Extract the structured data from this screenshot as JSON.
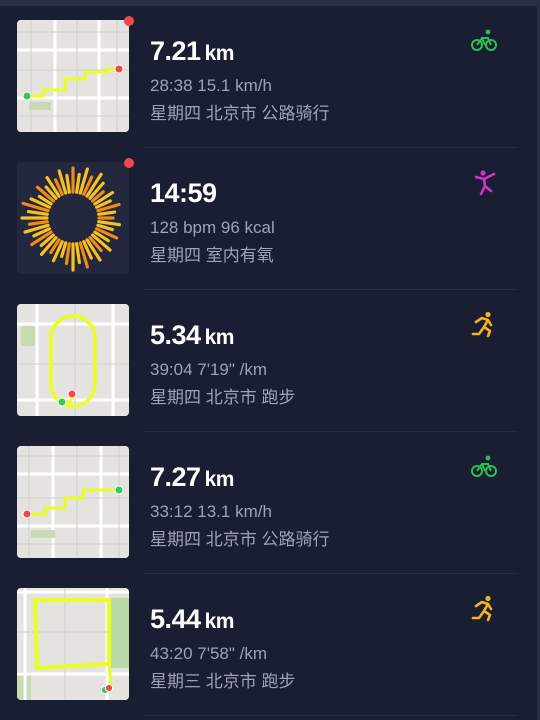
{
  "activities": [
    {
      "title_value": "7.21",
      "title_unit": "km",
      "stats": "28:38  15.1 km/h",
      "subtitle": "星期四 北京市 公路骑行",
      "sport": "cycling-icon",
      "icon_color": "#2fbf4f",
      "unread": true
    },
    {
      "title_value": "14:59",
      "title_unit": "",
      "stats": "128 bpm  96 kcal",
      "subtitle": "星期四 室内有氧",
      "sport": "yoga-icon",
      "icon_color": "#d033c9",
      "unread": true
    },
    {
      "title_value": "5.34",
      "title_unit": "km",
      "stats": "39:04  7'19\" /km",
      "subtitle": "星期四 北京市 跑步",
      "sport": "running-icon",
      "icon_color": "#f4b21f",
      "unread": false
    },
    {
      "title_value": "7.27",
      "title_unit": "km",
      "stats": "33:12  13.1 km/h",
      "subtitle": "星期四 北京市 公路骑行",
      "sport": "cycling-icon",
      "icon_color": "#2fbf4f",
      "unread": false
    },
    {
      "title_value": "5.44",
      "title_unit": "km",
      "stats": "43:20  7'58\" /km",
      "subtitle": "星期三 北京市 跑步",
      "sport": "running-icon",
      "icon_color": "#f4b21f",
      "unread": false
    }
  ],
  "colors": {
    "background": "#191e33",
    "route": "#e8ff1f",
    "start_marker": "#34c759",
    "end_marker": "#f0474a",
    "unread_dot": "#f0474a"
  }
}
